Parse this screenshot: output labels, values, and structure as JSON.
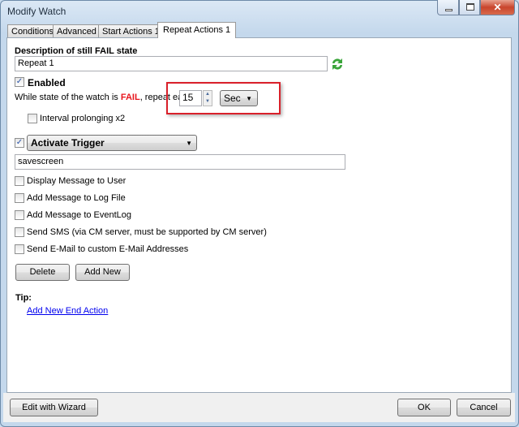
{
  "window": {
    "title": "Modify Watch"
  },
  "tabs": [
    {
      "label": "Conditions"
    },
    {
      "label": "Advanced"
    },
    {
      "label": "Start Actions 1"
    },
    {
      "label": "Repeat Actions 1",
      "selected": true
    }
  ],
  "form": {
    "description_label": "Description of still FAIL state",
    "description_value": "Repeat 1",
    "enabled_label": "Enabled",
    "enabled": true,
    "repeat_prefix": "While state of the watch is ",
    "repeat_state": "FAIL",
    "repeat_suffix": ", repeat each",
    "interval_value": "15",
    "interval_unit": "Sec",
    "interval_prolonging_label": "Interval prolonging x2",
    "interval_prolonging": false,
    "action_enabled": true,
    "action_type": "Activate Trigger",
    "action_param": "savescreen",
    "options": [
      {
        "label": "Display Message to User",
        "checked": false
      },
      {
        "label": "Add Message to Log File",
        "checked": false
      },
      {
        "label": "Add Message to EventLog",
        "checked": false
      },
      {
        "label": "Send SMS (via CM server, must be supported by CM server)",
        "checked": false
      },
      {
        "label": "Send E-Mail to custom E-Mail Addresses",
        "checked": false
      }
    ],
    "delete_label": "Delete",
    "add_new_label": "Add New",
    "tip_label": "Tip:",
    "tip_link": "Add New End Action"
  },
  "footer": {
    "wizard_label": "Edit with Wizard",
    "ok_label": "OK",
    "cancel_label": "Cancel"
  },
  "colors": {
    "fail": "#e8141c",
    "highlight": "#d9202a",
    "link": "#0000ee"
  }
}
